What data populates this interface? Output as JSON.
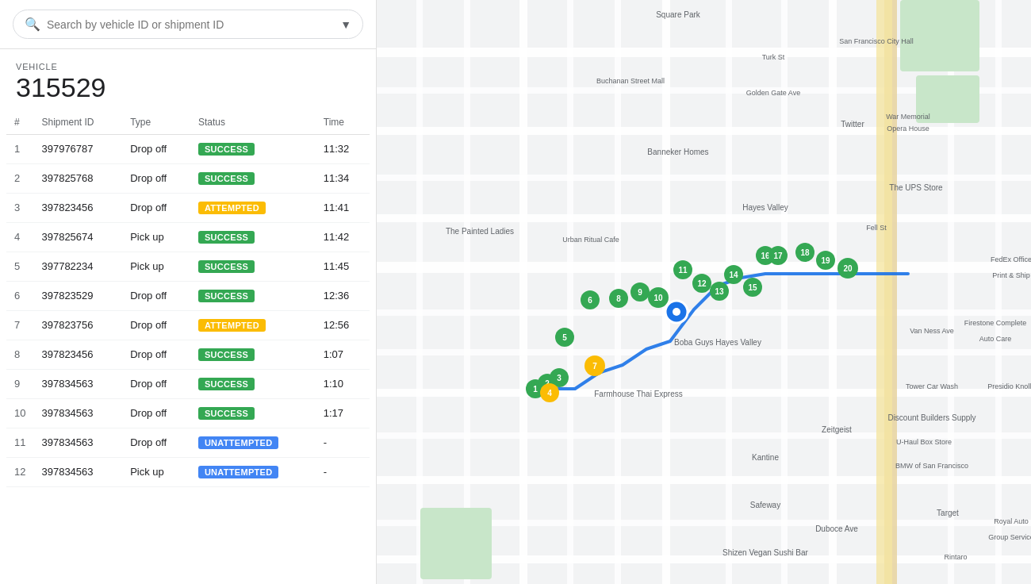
{
  "search": {
    "placeholder": "Search by vehicle ID or shipment ID"
  },
  "vehicle": {
    "label": "VEHICLE",
    "id": "315529"
  },
  "table": {
    "headers": [
      "#",
      "Shipment ID",
      "Type",
      "Status",
      "Time"
    ],
    "rows": [
      {
        "num": 1,
        "shipment_id": "397976787",
        "type": "Drop off",
        "status": "SUCCESS",
        "status_class": "badge-success",
        "time": "11:32"
      },
      {
        "num": 2,
        "shipment_id": "397825768",
        "type": "Drop off",
        "status": "SUCCESS",
        "status_class": "badge-success",
        "time": "11:34"
      },
      {
        "num": 3,
        "shipment_id": "397823456",
        "type": "Drop off",
        "status": "ATTEMPTED",
        "status_class": "badge-attempted",
        "time": "11:41"
      },
      {
        "num": 4,
        "shipment_id": "397825674",
        "type": "Pick up",
        "status": "SUCCESS",
        "status_class": "badge-success",
        "time": "11:42"
      },
      {
        "num": 5,
        "shipment_id": "397782234",
        "type": "Pick up",
        "status": "SUCCESS",
        "status_class": "badge-success",
        "time": "11:45"
      },
      {
        "num": 6,
        "shipment_id": "397823529",
        "type": "Drop off",
        "status": "SUCCESS",
        "status_class": "badge-success",
        "time": "12:36"
      },
      {
        "num": 7,
        "shipment_id": "397823756",
        "type": "Drop off",
        "status": "ATTEMPTED",
        "status_class": "badge-attempted",
        "time": "12:56"
      },
      {
        "num": 8,
        "shipment_id": "397823456",
        "type": "Drop off",
        "status": "SUCCESS",
        "status_class": "badge-success",
        "time": "1:07"
      },
      {
        "num": 9,
        "shipment_id": "397834563",
        "type": "Drop off",
        "status": "SUCCESS",
        "status_class": "badge-success",
        "time": "1:10"
      },
      {
        "num": 10,
        "shipment_id": "397834563",
        "type": "Drop off",
        "status": "SUCCESS",
        "status_class": "badge-success",
        "time": "1:17"
      },
      {
        "num": 11,
        "shipment_id": "397834563",
        "type": "Drop off",
        "status": "UNATTEMPTED",
        "status_class": "badge-unattempted",
        "time": "-"
      },
      {
        "num": 12,
        "shipment_id": "397834563",
        "type": "Pick up",
        "status": "UNATTEMPTED",
        "status_class": "badge-unattempted",
        "time": "-"
      }
    ]
  }
}
